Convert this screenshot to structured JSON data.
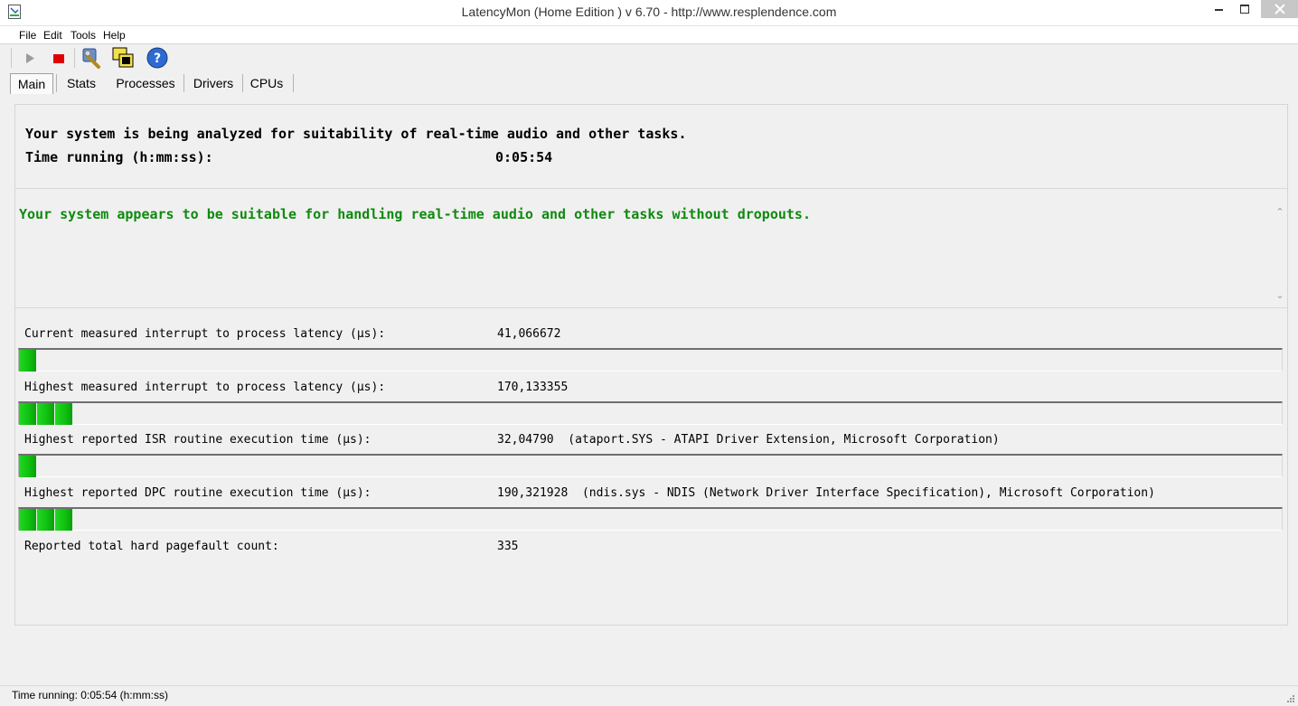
{
  "window": {
    "title": "LatencyMon  (Home Edition )  v 6.70 - http://www.resplendence.com"
  },
  "menu": {
    "items": [
      "File",
      "Edit",
      "Tools",
      "Help"
    ]
  },
  "toolbar": {
    "icons": [
      "play-icon",
      "stop-icon",
      "wrench-icon",
      "windows-icon",
      "help-icon"
    ]
  },
  "tabs": [
    "Main",
    "Stats",
    "Processes",
    "Drivers",
    "CPUs"
  ],
  "main": {
    "header_line1": "Your system is being analyzed for suitability of real-time audio and other tasks.",
    "time_label": "Time running (h:mm:ss):",
    "time_value": "0:05:54",
    "verdict": "Your system appears to be suitable for handling real-time audio and other tasks without dropouts.",
    "verdict_color": "#0e8a0e",
    "metrics": [
      {
        "label": "Current measured interrupt to process latency (µs):",
        "value": "41,066672",
        "detail": "",
        "bar_segments": 1
      },
      {
        "label": "Highest measured interrupt to process latency (µs):",
        "value": "170,133355",
        "detail": "",
        "bar_segments": 3
      },
      {
        "label": "Highest reported ISR routine execution time (µs):",
        "value": "32,04790",
        "detail": "(ataport.SYS - ATAPI Driver Extension, Microsoft Corporation)",
        "bar_segments": 1
      },
      {
        "label": "Highest reported DPC routine execution time (µs):",
        "value": "190,321928",
        "detail": "(ndis.sys - NDIS (Network Driver Interface Specification), Microsoft Corporation)",
        "bar_segments": 3
      }
    ],
    "pagefault_label": "Reported total hard pagefault count:",
    "pagefault_value": "335"
  },
  "statusbar": {
    "text": "Time running: 0:05:54  (h:mm:ss)"
  },
  "colors": {
    "bar_green": "#11c211",
    "stop_red": "#e00000"
  }
}
